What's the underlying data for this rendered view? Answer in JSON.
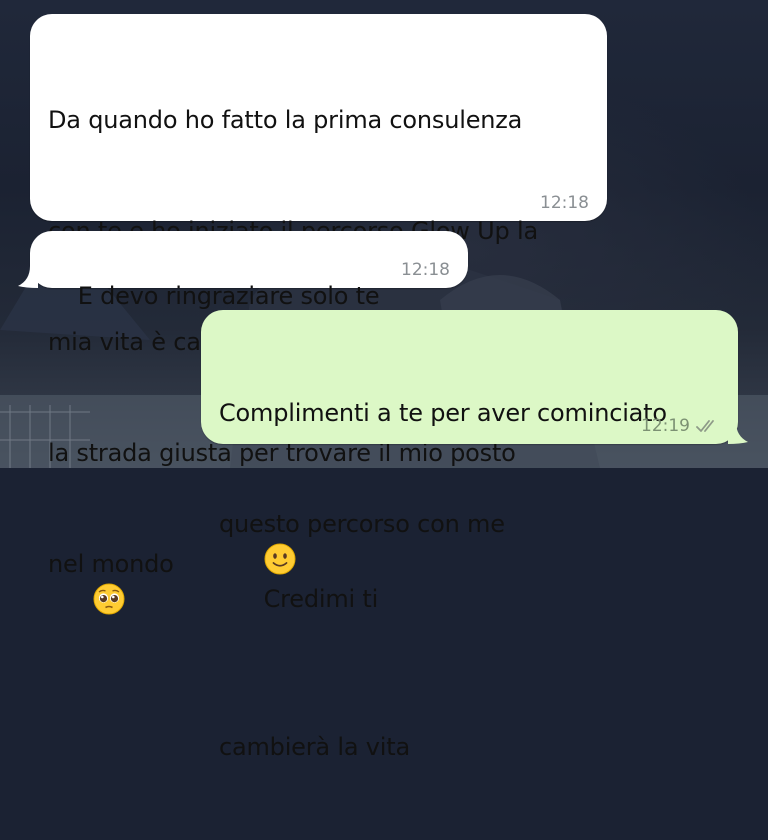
{
  "messages": [
    {
      "direction": "incoming",
      "lines": [
        "Da quando ho fatto la prima consulenza",
        "con te e ho iniziato il percorso Glow Up la",
        "mia vita è cambiata!!!! Sento che questa è",
        "la strada giusta per trovare il mio posto",
        "nel mondo"
      ],
      "emoji": "pleading-face-emoji",
      "time": "12:18"
    },
    {
      "direction": "incoming",
      "lines": [
        "E devo ringraziare solo te"
      ],
      "time": "12:18"
    },
    {
      "direction": "outgoing",
      "line1": "Complimenti a te per aver cominciato",
      "line2_before": "questo percorso con me",
      "emoji": "slightly-smiling-face-emoji",
      "line2_after": "Credimi ti",
      "line3": "cambierà la vita",
      "time": "12:19",
      "status_icon": "double-check-icon"
    }
  ],
  "colors": {
    "incoming_bubble": "#ffffff",
    "outgoing_bubble": "#dcf8c6",
    "background": "#1b2233"
  }
}
